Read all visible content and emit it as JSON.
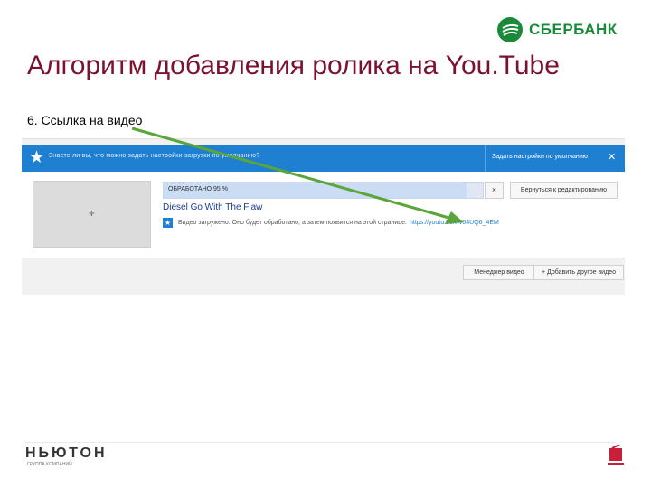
{
  "brand": {
    "logo_text": "СБЕРБАНК",
    "color": "#1a8a3a"
  },
  "slide": {
    "title": "Алгоритм добавления ролика на You.Tube",
    "subtitle": "6. Ссылка на видео",
    "title_color": "#7a1230"
  },
  "notice_bar": {
    "text": "Знаете ли вы, что можно задать настройки загрузки по умолчанию?",
    "set_default_label": "Задать настройки по умолчанию",
    "close_icon": "close-icon",
    "color": "#1f7fd0"
  },
  "upload": {
    "progress_label": "ОБРАБОТАНО 95 %",
    "progress_percent": 95,
    "cancel_label": "×",
    "back_label": "Вернуться к редактированию",
    "video_title": "Diesel Go With The Flaw",
    "info_text": "Видео загружено. Оно будет обработано, а затем появится на этой странице:",
    "video_link": "https://youtu.be/tW04UQ6_4EM"
  },
  "bottom_buttons": {
    "video_manager": "Менеджер видео",
    "add_more": "+ Добавить другое видео"
  },
  "footer": {
    "brand": "НЬЮТОН",
    "tagline": "ГРУППА КОМПАНИЙ"
  }
}
